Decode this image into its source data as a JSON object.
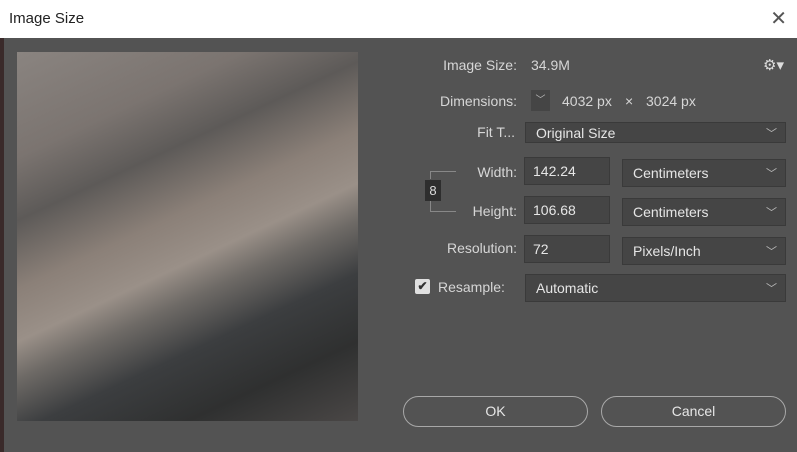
{
  "window": {
    "title": "Image Size",
    "close": "✕"
  },
  "image_size": {
    "label": "Image Size:",
    "value": "34.9M"
  },
  "dimensions": {
    "label": "Dimensions:",
    "width": "4032 px",
    "times": "×",
    "height": "3024 px"
  },
  "fit_to": {
    "label": "Fit T...",
    "value": "Original Size"
  },
  "width": {
    "label": "Width:",
    "value": "142.24",
    "unit": "Centimeters"
  },
  "height": {
    "label": "Height:",
    "value": "106.68",
    "unit": "Centimeters"
  },
  "resolution": {
    "label": "Resolution:",
    "value": "72",
    "unit": "Pixels/Inch"
  },
  "resample": {
    "label": "Resample:",
    "value": "Automatic",
    "checked": true
  },
  "buttons": {
    "ok": "OK",
    "cancel": "Cancel"
  }
}
